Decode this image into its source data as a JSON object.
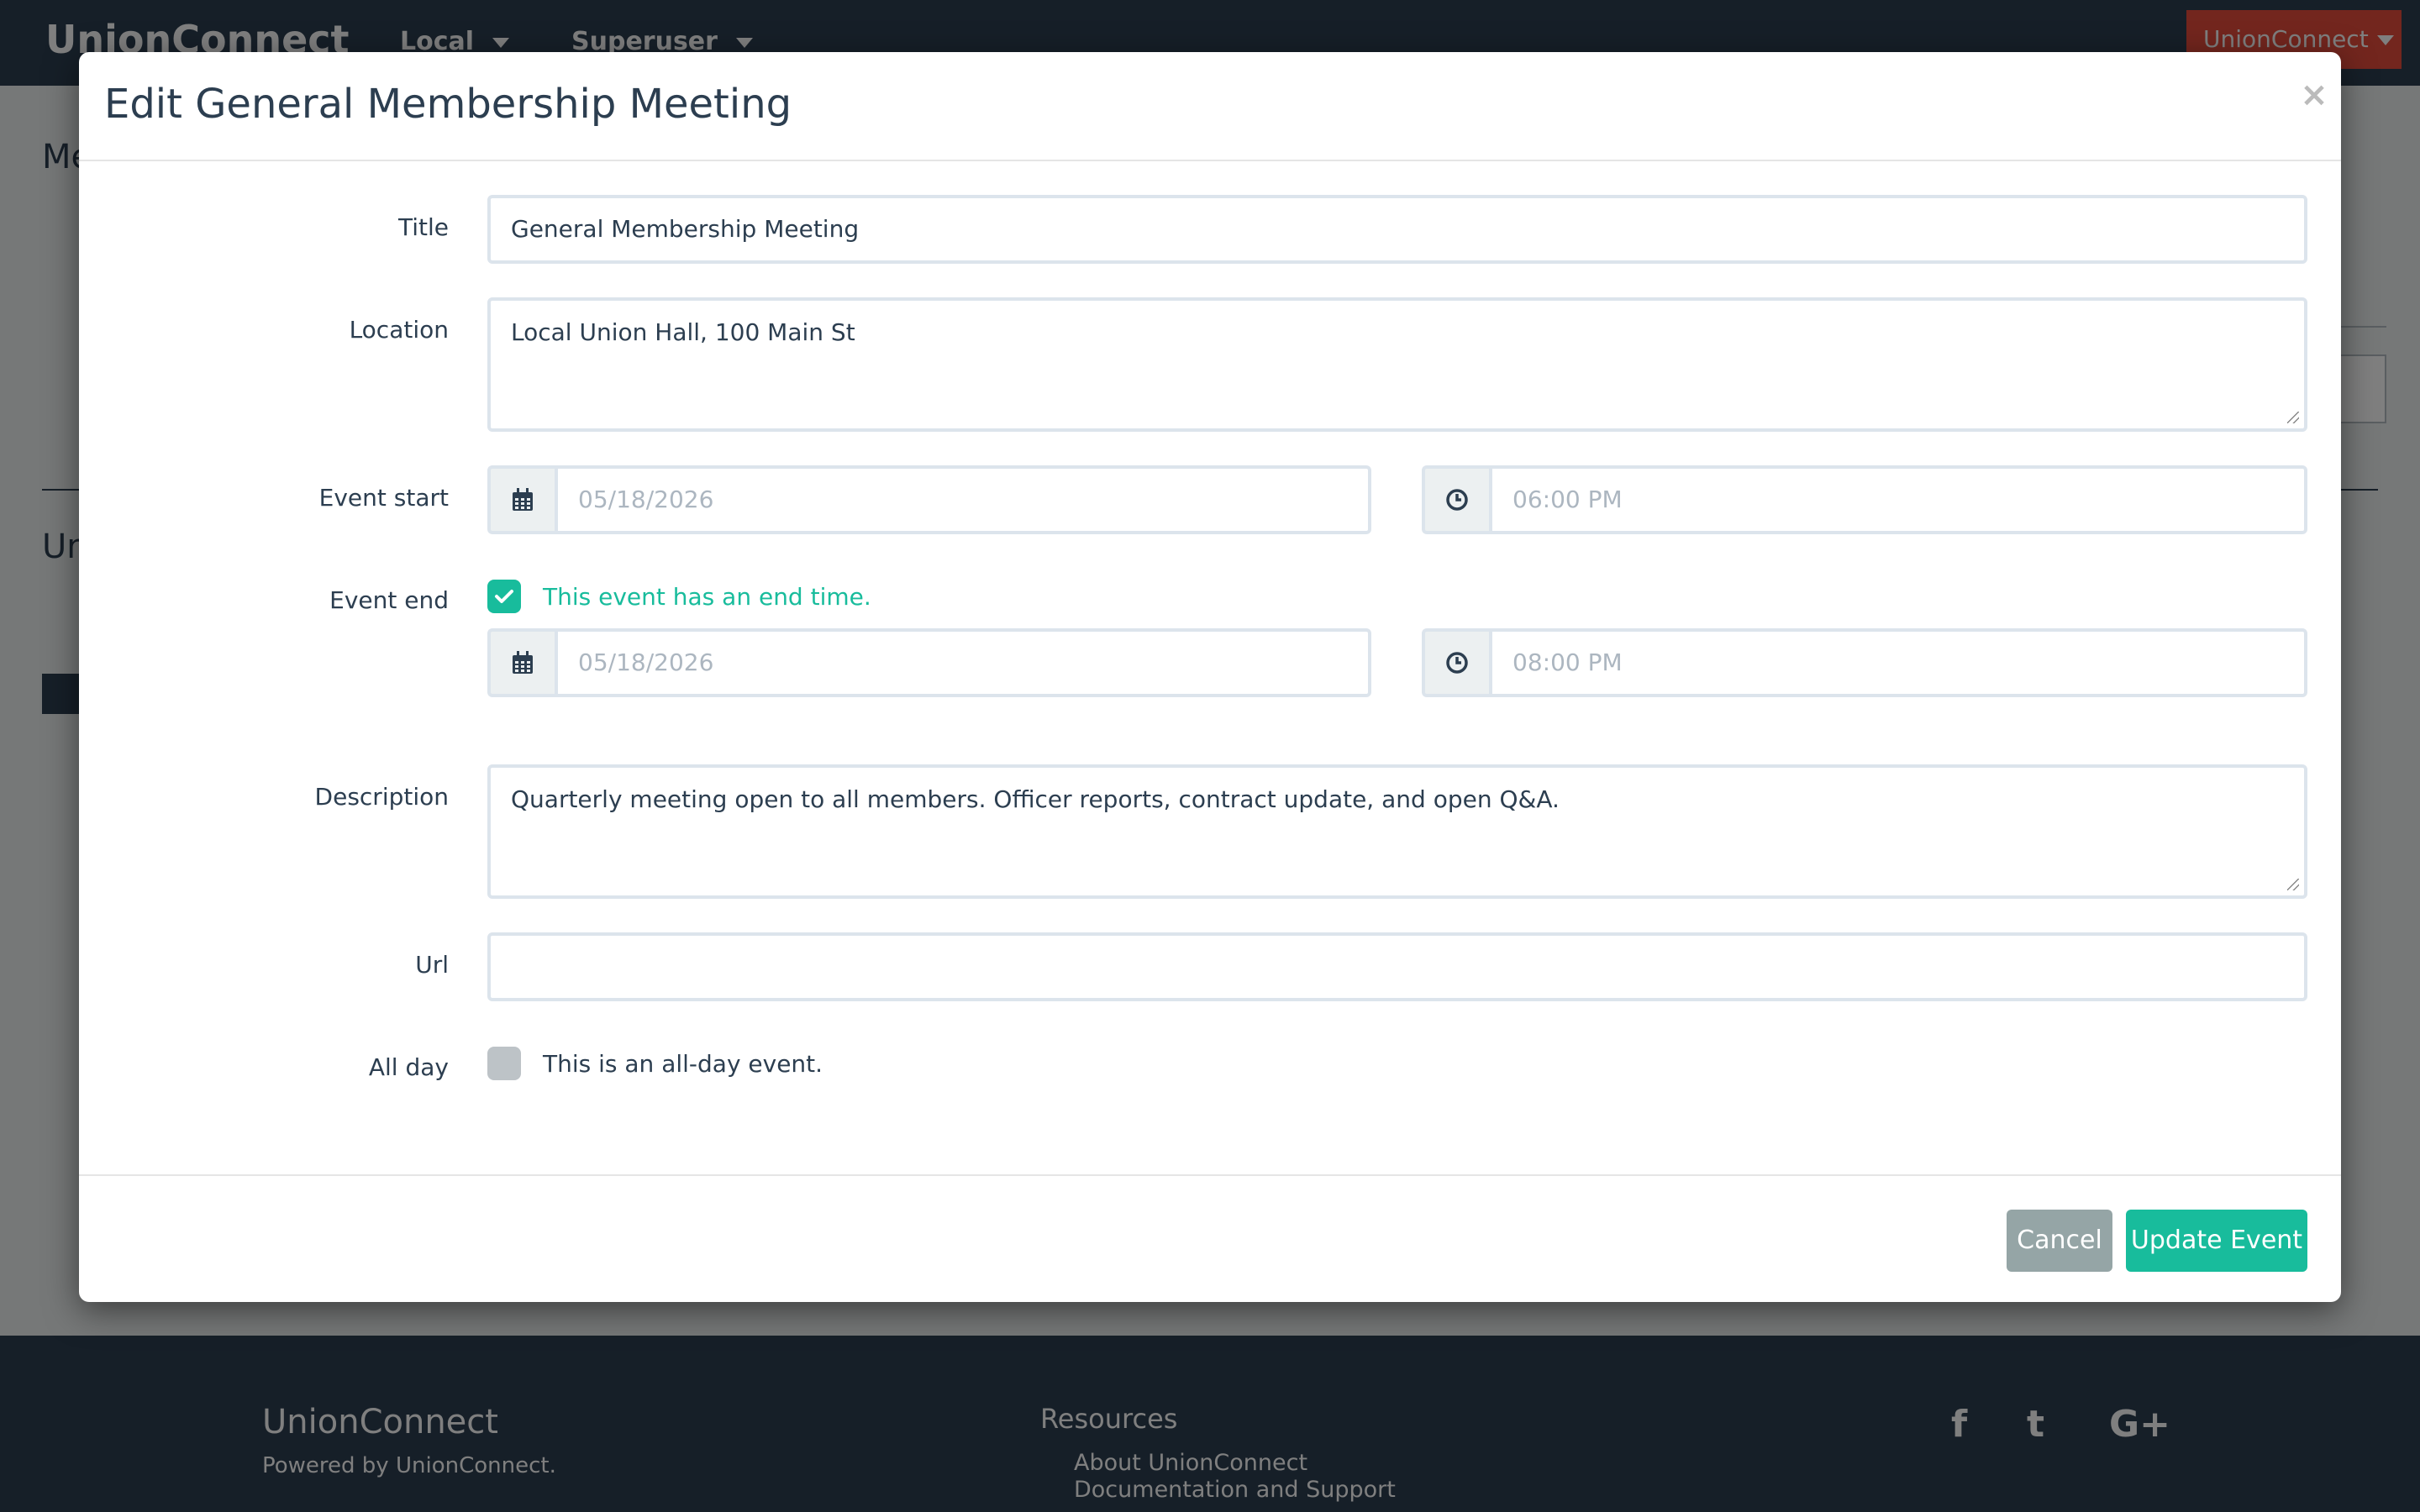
{
  "navbar": {
    "brand": "UnionConnect",
    "local_label": "Local",
    "superuser_label": "Superuser",
    "account_label": "UnionConnect"
  },
  "background": {
    "heading_top": "Me",
    "heading_mid": "Un"
  },
  "footer": {
    "brand": "UnionConnect",
    "powered_by": "Powered by UnionConnect.",
    "resources_title": "Resources",
    "links": [
      "About UnionConnect",
      "Documentation and Support"
    ],
    "social": [
      "facebook-icon",
      "twitter-icon",
      "google-plus-icon"
    ]
  },
  "modal": {
    "title": "Edit General Membership Meeting",
    "close_label": "×",
    "fields": {
      "title_label": "Title",
      "title_value": "General Membership Meeting",
      "location_label": "Location",
      "location_value": "Local Union Hall, 100 Main St",
      "event_start_label": "Event start",
      "start_date": "05/18/2026",
      "start_time": "06:00 PM",
      "event_end_label": "Event end",
      "end_time_checkbox_label": "This event has an end time.",
      "end_time_checked": true,
      "end_date": "05/18/2026",
      "end_time": "08:00 PM",
      "description_label": "Description",
      "description_value": "Quarterly meeting open to all members. Officer reports, contract update, and open Q&A.",
      "url_label": "Url",
      "url_value": "",
      "all_day_label": "All day",
      "all_day_checkbox_label": "This is an all-day event.",
      "all_day_checked": false
    },
    "buttons": {
      "cancel": "Cancel",
      "submit": "Update Event"
    }
  },
  "colors": {
    "primary": "#18bc9c",
    "navbar": "#2c3e50",
    "danger": "#e74c3c",
    "cancel": "#95a5a6"
  }
}
